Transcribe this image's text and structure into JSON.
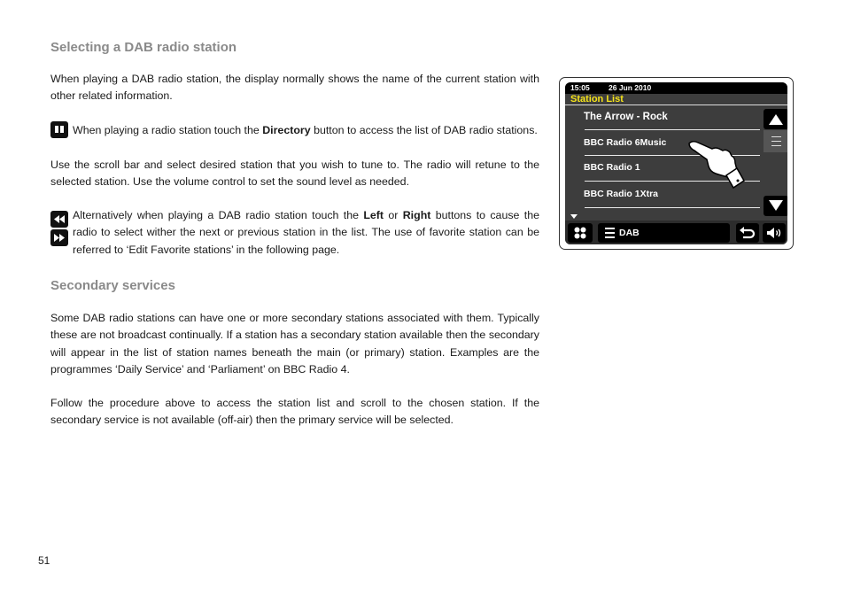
{
  "section1": {
    "heading": "Selecting a DAB radio station",
    "p1": "When playing a DAB radio station, the display normally shows the name of the current station with other related information.",
    "p2_pre": " When playing a radio station touch the ",
    "p2_bold": "Directory",
    "p2_post": " button to access the list of DAB radio stations.",
    "p3": "Use the scroll bar and select desired station that you wish to tune to. The radio will retune to the selected station. Use the volume control to set the sound level as needed.",
    "p4_pre": "Alternatively when playing a DAB radio station touch the ",
    "p4_left": "Left",
    "p4_mid": " or ",
    "p4_right": "Right",
    "p4_post": " buttons to cause the radio to select wither the next or previous station in the list. The use of favorite station can be referred to ‘Edit Favorite stations’ in the following page."
  },
  "section2": {
    "heading": "Secondary services",
    "p1": "Some DAB radio stations can have one or more secondary stations associated with them. Typically these are not broadcast continually. If a station has a secondary station available then the secondary will appear in the list of station names beneath the main (or primary) station. Examples are the programmes ‘Daily Service’ and ‘Parliament’ on BBC Radio 4.",
    "p2": "Follow the procedure above to access the station list and scroll to the chosen station. If the secondary service is not available (off-air) then the primary service will be selected."
  },
  "icons": {
    "directory": "book-icon",
    "left": "rewind-icon",
    "right": "fast-forward-icon"
  },
  "display": {
    "time": "15:05",
    "date": "26 Jun 2010",
    "title": "Station List",
    "title_color": "#f5e31a",
    "stations": [
      "The Arrow - Rock",
      "BBC Radio 6Music",
      "BBC Radio 1",
      "BBC Radio 1Xtra"
    ],
    "source_label": "DAB"
  },
  "page_number": "51"
}
